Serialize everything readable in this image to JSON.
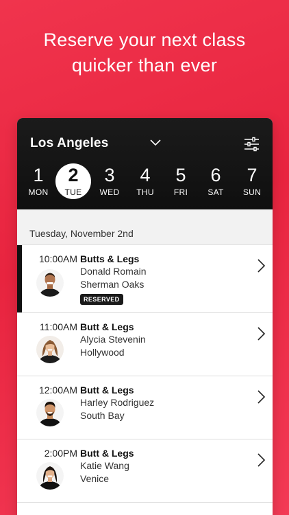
{
  "headline": {
    "line1": "Reserve your next class",
    "line2": "quicker than ever"
  },
  "header": {
    "city": "Los Angeles",
    "city_dropdown_icon": "chevron-down-icon",
    "filter_icon": "sliders-icon"
  },
  "days": [
    {
      "num": "1",
      "name": "MON",
      "active": false
    },
    {
      "num": "2",
      "name": "TUE",
      "active": true
    },
    {
      "num": "3",
      "name": "WED",
      "active": false
    },
    {
      "num": "4",
      "name": "THU",
      "active": false
    },
    {
      "num": "5",
      "name": "FRI",
      "active": false
    },
    {
      "num": "6",
      "name": "SAT",
      "active": false
    },
    {
      "num": "7",
      "name": "SUN",
      "active": false
    }
  ],
  "date_label": "Tuesday, November 2nd",
  "classes": [
    {
      "time": "10:00AM",
      "name": "Butts & Legs",
      "instructor": "Donald Romain",
      "location": "Sherman Oaks",
      "badge": "RESERVED"
    },
    {
      "time": "11:00AM",
      "name": "Butt & Legs",
      "instructor": "Alycia Stevenin",
      "location": "Hollywood"
    },
    {
      "time": "12:00AM",
      "name": "Butt & Legs",
      "instructor": "Harley Rodriguez",
      "location": "South Bay"
    },
    {
      "time": "2:00PM",
      "name": "Butt & Legs",
      "instructor": "Katie Wang",
      "location": "Venice"
    }
  ],
  "colors": {
    "brand_red": "#e8243f",
    "header_black": "#111111"
  }
}
